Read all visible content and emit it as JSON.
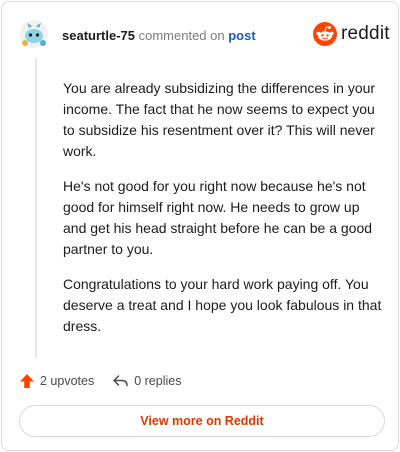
{
  "header": {
    "username": "seaturtle-75",
    "action": "commented on",
    "post_link": "post",
    "brand": "reddit"
  },
  "comment": {
    "paragraphs": [
      "You are already subsidizing the differences in your income. The fact that he now seems to expect you to subsidize his resentment over it? This will never work.",
      "He's not good for you right now because he's not good for himself right now. He needs to grow up and get his head straight before he can be a good partner to you.",
      "Congratulations to your hard work paying off. You deserve a treat and I hope you look fabulous in that dress."
    ]
  },
  "actions": {
    "upvotes": "2 upvotes",
    "replies": "0 replies"
  },
  "footer": {
    "view_more": "View more on Reddit"
  },
  "colors": {
    "reddit_orange": "#ff4500",
    "link_blue": "#1a5fb4",
    "button_text": "#d93a00"
  }
}
